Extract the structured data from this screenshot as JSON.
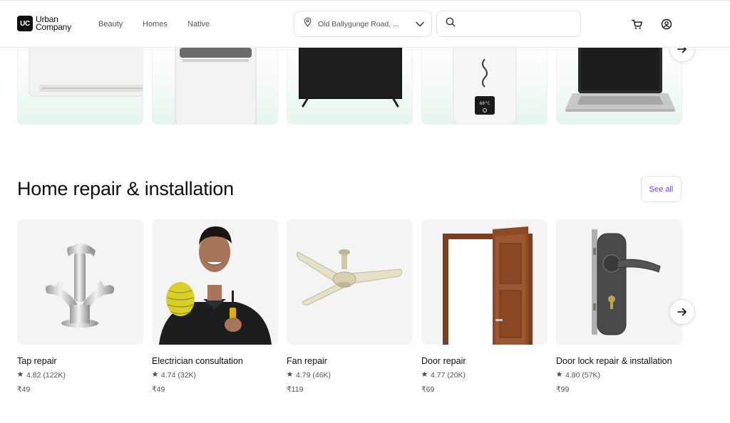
{
  "brand": {
    "mark": "UC",
    "line1": "Urban",
    "line2": "Company"
  },
  "nav": [
    {
      "label": "Beauty"
    },
    {
      "label": "Homes"
    },
    {
      "label": "Native"
    }
  ],
  "location": {
    "value": "Old Ballygunge Road, ..."
  },
  "search": {
    "placeholder": ""
  },
  "top_row_icons": [
    "air-conditioner",
    "washing-machine",
    "television",
    "water-heater",
    "laptop"
  ],
  "water_heater_display": "60°C",
  "section": {
    "title": "Home repair & installation",
    "see_all": "See all",
    "items": [
      {
        "name": "Tap repair",
        "rating": "4.82 (122K)",
        "price": "₹49"
      },
      {
        "name": "Electrician consultation",
        "rating": "4.74 (32K)",
        "price": "₹49"
      },
      {
        "name": "Fan repair",
        "rating": "4.79 (46K)",
        "price": "₹119"
      },
      {
        "name": "Door repair",
        "rating": "4.77 (20K)",
        "price": "₹69"
      },
      {
        "name": "Door lock repair & installation",
        "rating": "4.80 (57K)",
        "price": "₹99"
      }
    ]
  },
  "colors": {
    "accent": "#6e42e5",
    "text": "#0f0f0f",
    "muted": "#545454"
  }
}
